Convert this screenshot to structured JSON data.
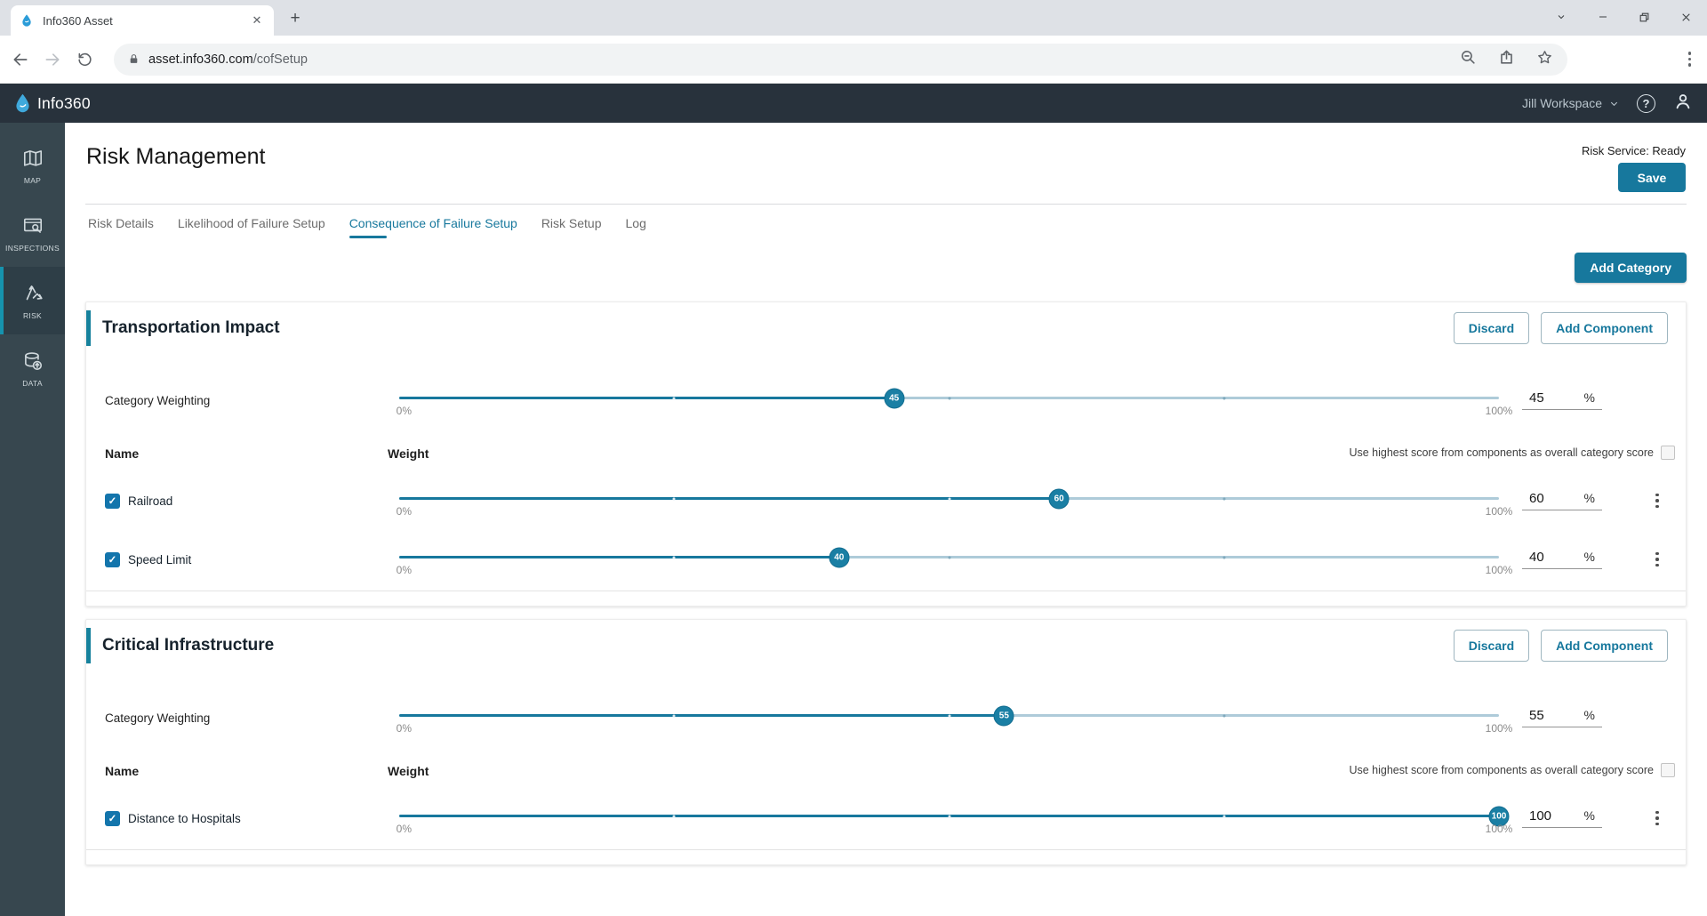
{
  "browser": {
    "tab_title": "Info360 Asset",
    "url_domain": "asset.info360.com",
    "url_path": "/cofSetup"
  },
  "navbar": {
    "brand": "Info360",
    "workspace_label": "Jill Workspace"
  },
  "sidebar": {
    "items": [
      {
        "label": "MAP",
        "icon": "map-icon",
        "active": false
      },
      {
        "label": "INSPECTIONS",
        "icon": "inspections-icon",
        "active": false
      },
      {
        "label": "RISK",
        "icon": "risk-icon",
        "active": true
      },
      {
        "label": "DATA",
        "icon": "data-icon",
        "active": false
      }
    ]
  },
  "page": {
    "title": "Risk Management",
    "status_text": "Risk Service: Ready",
    "save_label": "Save",
    "add_category_label": "Add Category"
  },
  "tabs": [
    {
      "label": "Risk Details",
      "active": false
    },
    {
      "label": "Likelihood of Failure Setup",
      "active": false
    },
    {
      "label": "Consequence of Failure Setup",
      "active": true
    },
    {
      "label": "Risk Setup",
      "active": false
    },
    {
      "label": "Log",
      "active": false
    }
  ],
  "ui": {
    "min_label": "0%",
    "max_label": "100%",
    "percent": "%",
    "name_header": "Name",
    "weight_header": "Weight",
    "highest_score_label": "Use highest score from components as overall category score",
    "discard_label": "Discard",
    "add_component_label": "Add Component",
    "weighting_label": "Category Weighting",
    "glyphs": {
      "close": "✕",
      "plus": "+",
      "check": "✓",
      "help": "?"
    }
  },
  "categories": [
    {
      "title": "Transportation Impact",
      "weight": 45,
      "components": [
        {
          "name": "Railroad",
          "weight": 60,
          "checked": true
        },
        {
          "name": "Speed Limit",
          "weight": 40,
          "checked": true
        }
      ]
    },
    {
      "title": "Critical Infrastructure",
      "weight": 55,
      "components": [
        {
          "name": "Distance to Hospitals",
          "weight": 100,
          "checked": true
        }
      ]
    }
  ],
  "colors": {
    "primary": "#17789d",
    "track": "#aecbd9",
    "checkbox": "#1375ac",
    "navbar_bg": "#28323c",
    "sidebar_bg": "#37474f"
  }
}
